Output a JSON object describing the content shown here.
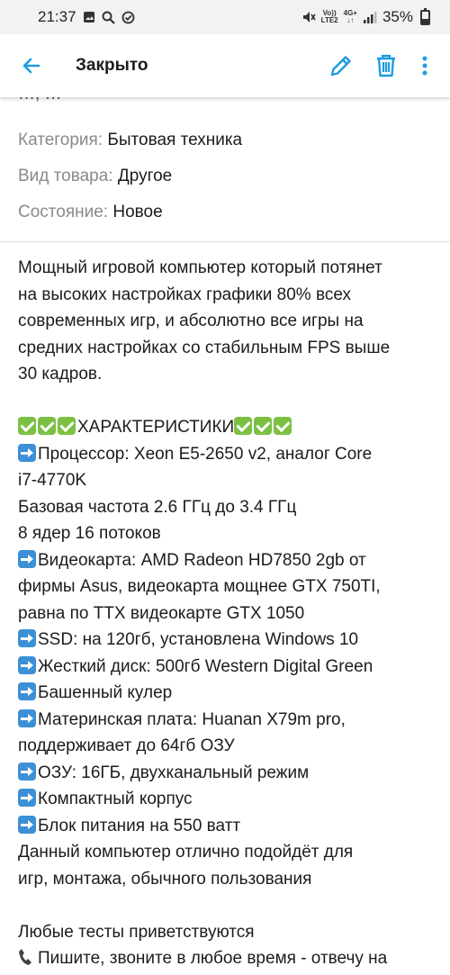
{
  "status_bar": {
    "time": "21:37",
    "battery": "35%",
    "battery_level": 0.35,
    "net_top": "Vo))",
    "net_bottom": "LTE2",
    "signal_top": "4G+"
  },
  "app_bar": {
    "title": "Закрыто",
    "icons": [
      "back-arrow-icon",
      "edit-pencil-icon",
      "trash-icon",
      "more-vertical-icon"
    ],
    "accent_color": "#1e9be0"
  },
  "cut_text": "…, …",
  "attributes": [
    {
      "key": "Категория:",
      "value": "Бытовая техника"
    },
    {
      "key": "Вид товара:",
      "value": "Другое"
    },
    {
      "key": "Состояние:",
      "value": "Новое"
    }
  ],
  "description": {
    "intro": [
      "Мощный игровой компьютер который потянет",
      "на высоких настройках графики 80% всех",
      "современных игр, и абсолютно все игры на",
      "средних настройках со стабильным FPS выше",
      "30 кадров."
    ],
    "specs_header": "ХАРАКТЕРИСТИКИ",
    "specs": [
      {
        "arrow": true,
        "text": "Процессор: Xeon E5-2650 v2, аналог Core"
      },
      {
        "arrow": false,
        "text": "i7-4770K"
      },
      {
        "arrow": false,
        "text": "Базовая частота 2.6 ГГц до 3.4 ГГц"
      },
      {
        "arrow": false,
        "text": "8 ядер 16 потоков"
      },
      {
        "arrow": true,
        "text": "Видеокарта: AMD Radeon HD7850 2gb от"
      },
      {
        "arrow": false,
        "text": "фирмы Asus, видеокарта мощнее GTX 750TI,"
      },
      {
        "arrow": false,
        "text": "равна по ТТХ видеокарте GTX 1050"
      },
      {
        "arrow": true,
        "text": "SSD: на 120гб, установлена Windows 10"
      },
      {
        "arrow": true,
        "text": "Жесткий диск: 500гб Western Digital Green"
      },
      {
        "arrow": true,
        "text": "Башенный кулер"
      },
      {
        "arrow": true,
        "text": "Материнская плата: Huanan X79m pro,"
      },
      {
        "arrow": false,
        "text": "поддерживает до 64гб ОЗУ"
      },
      {
        "arrow": true,
        "text": "ОЗУ: 16ГБ, двухканальный режим"
      },
      {
        "arrow": true,
        "text": "Компактный корпус"
      },
      {
        "arrow": true,
        "text": "Блок питания на 550 ватт"
      }
    ],
    "outro": [
      "Данный компьютер отлично подойдёт для",
      "игр, монтажа, обычного пользования"
    ],
    "tests": "Любые тесты приветствуются",
    "contact": "Пишите, звоните в любое время - отвечу на"
  }
}
